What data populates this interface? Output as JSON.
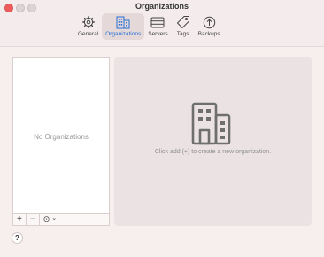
{
  "window": {
    "title": "Organizations"
  },
  "toolbar": {
    "items": [
      {
        "label": "General",
        "icon": "gear-icon"
      },
      {
        "label": "Organizations",
        "icon": "building-icon",
        "selected": true
      },
      {
        "label": "Servers",
        "icon": "server-icon"
      },
      {
        "label": "Tags",
        "icon": "tag-icon"
      },
      {
        "label": "Backups",
        "icon": "backup-icon"
      }
    ]
  },
  "list": {
    "empty_text": "No Organizations"
  },
  "list_footer": {
    "add_label": "+",
    "remove_label": "−",
    "more_label": "⊙",
    "more_chevron": "⌄"
  },
  "detail": {
    "icon": "building-icon",
    "hint": "Click add (+) to create a new organization."
  },
  "help": {
    "label": "?"
  },
  "colors": {
    "accent": "#2a6fd6",
    "close": "#ee5d5d"
  }
}
